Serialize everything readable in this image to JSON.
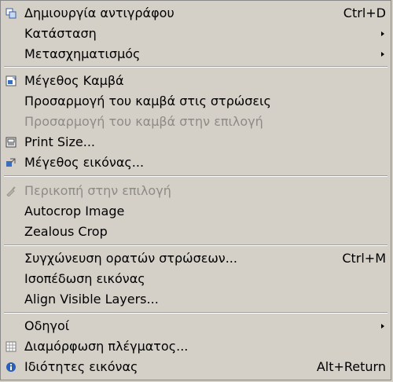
{
  "items": [
    {
      "label": "Δημιουργία αντιγράφου",
      "accel": "Ctrl+D",
      "icon": "duplicate-icon"
    },
    {
      "label": "Κατάσταση",
      "submenu": true
    },
    {
      "label": "Μετασχηματισμός",
      "submenu": true
    },
    {
      "label": "Μέγεθος Καμβά",
      "icon": "canvas-size-icon"
    },
    {
      "label": "Προσαρμογή του καμβά στις στρώσεις"
    },
    {
      "label": "Προσαρμογή του καμβά στην επιλογή",
      "disabled": true
    },
    {
      "label": "Print Size...",
      "icon": "print-size-icon"
    },
    {
      "label": "Μέγεθος εικόνας...",
      "icon": "scale-image-icon"
    },
    {
      "label": "Περικοπή στην επιλογή",
      "disabled": true,
      "icon": "crop-icon"
    },
    {
      "label": "Autocrop Image"
    },
    {
      "label": "Zealous Crop"
    },
    {
      "label": "Συγχώνευση ορατών στρώσεων...",
      "accel": "Ctrl+M"
    },
    {
      "label": "Ισοπέδωση εικόνας"
    },
    {
      "label": "Align Visible Layers..."
    },
    {
      "label": "Οδηγοί",
      "submenu": true
    },
    {
      "label": "Διαμόρφωση πλέγματος...",
      "icon": "grid-icon"
    },
    {
      "label": "Ιδιότητες εικόνας",
      "accel": "Alt+Return",
      "icon": "info-icon"
    }
  ],
  "colors": {
    "background": "#d4d0c8",
    "disabled_text": "#8e8b86",
    "info_icon": "#2a5fb7"
  }
}
